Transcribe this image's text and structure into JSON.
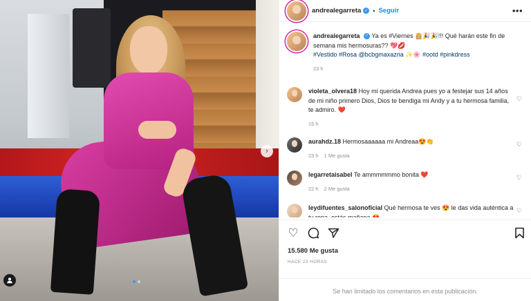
{
  "post": {
    "author": "andrealegarreta",
    "follow_label": "Seguir",
    "separator": "•",
    "more_icon": "more-options-icon",
    "next_icon": "chevron-right-icon"
  },
  "caption": {
    "author": "andrealegarreta",
    "line1": "Ya es #Viernes 👸🏼🎉🎉!!! Qué harán este fin de semana mis hermosuras?? 💖💋",
    "line2": "#Vestido #Rosa @bcbgmaxazria ✨🌸 #ootd #pinkdress",
    "time": "23 h"
  },
  "comments": [
    {
      "user": "violeta_olvera18",
      "text": "Hoy mi querida Andrea pues yo a festejar sus 14 años de mi niño primero Dios, Dios te bendiga mi Andy y a tu hermosa familia, te admiro. ❤️",
      "time": "15 h",
      "likes": ""
    },
    {
      "user": "aurahdz.18",
      "text": "Hermosaaaaaa mi Andreaa😍👏",
      "time": "23 h",
      "likes": "1 Me gusta"
    },
    {
      "user": "legarretaisabel",
      "text": "Te ammmmmmo bonita ❤️",
      "time": "22 h",
      "likes": "2 Me gusta"
    },
    {
      "user": "leydifuentes_salonoficial",
      "text": "Qué hermosa te ves 😍 le das vida auténtica a tu ropa, estás mañana 😍",
      "time": "",
      "likes": ""
    }
  ],
  "footer": {
    "likes": "15.580 Me gusta",
    "time": "HACE 23 HORAS",
    "limited": "Se han limitado los comentarios en esta publicación."
  },
  "colors": {
    "accent": "#0095f6",
    "verified": "#3897f0",
    "muted": "#8e8e8e",
    "dress": "#d93ea3"
  }
}
